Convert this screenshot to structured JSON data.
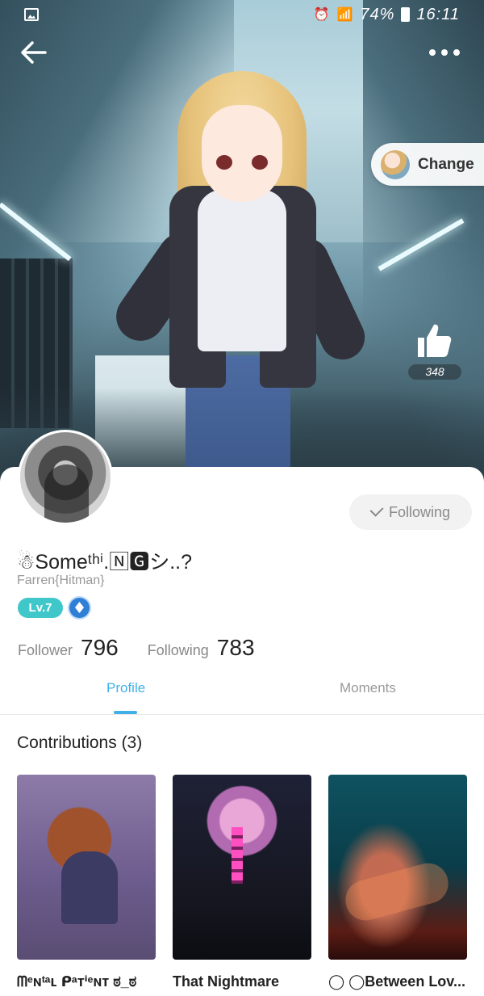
{
  "status_bar": {
    "battery": "74%",
    "time": "16:11"
  },
  "hero": {
    "change_label": "Change",
    "like_count": "348"
  },
  "profile": {
    "username": "☃Someᵗʰⁱ.🄽🅶シ..?",
    "nickname": "Farren{Hitman}",
    "level": "Lv.7",
    "follow_button_label": "Following",
    "stats": {
      "follower_label": "Follower",
      "follower_count": "796",
      "following_label": "Following",
      "following_count": "783"
    }
  },
  "tabs": [
    {
      "label": "Profile",
      "active": true
    },
    {
      "label": "Moments",
      "active": false
    }
  ],
  "contributions": {
    "title": "Contributions (3)",
    "items": [
      {
        "title": "ᗰᵉɴᵗᵃʟ ᑭᵃᴛⁱᵉɴᴛ ಠ_ಠ"
      },
      {
        "title": "That Nightmare"
      },
      {
        "title": "◯ ◯Between Lov..."
      }
    ]
  },
  "colors": {
    "accent": "#3fb0e8",
    "level_badge": "#3fc7c9"
  }
}
